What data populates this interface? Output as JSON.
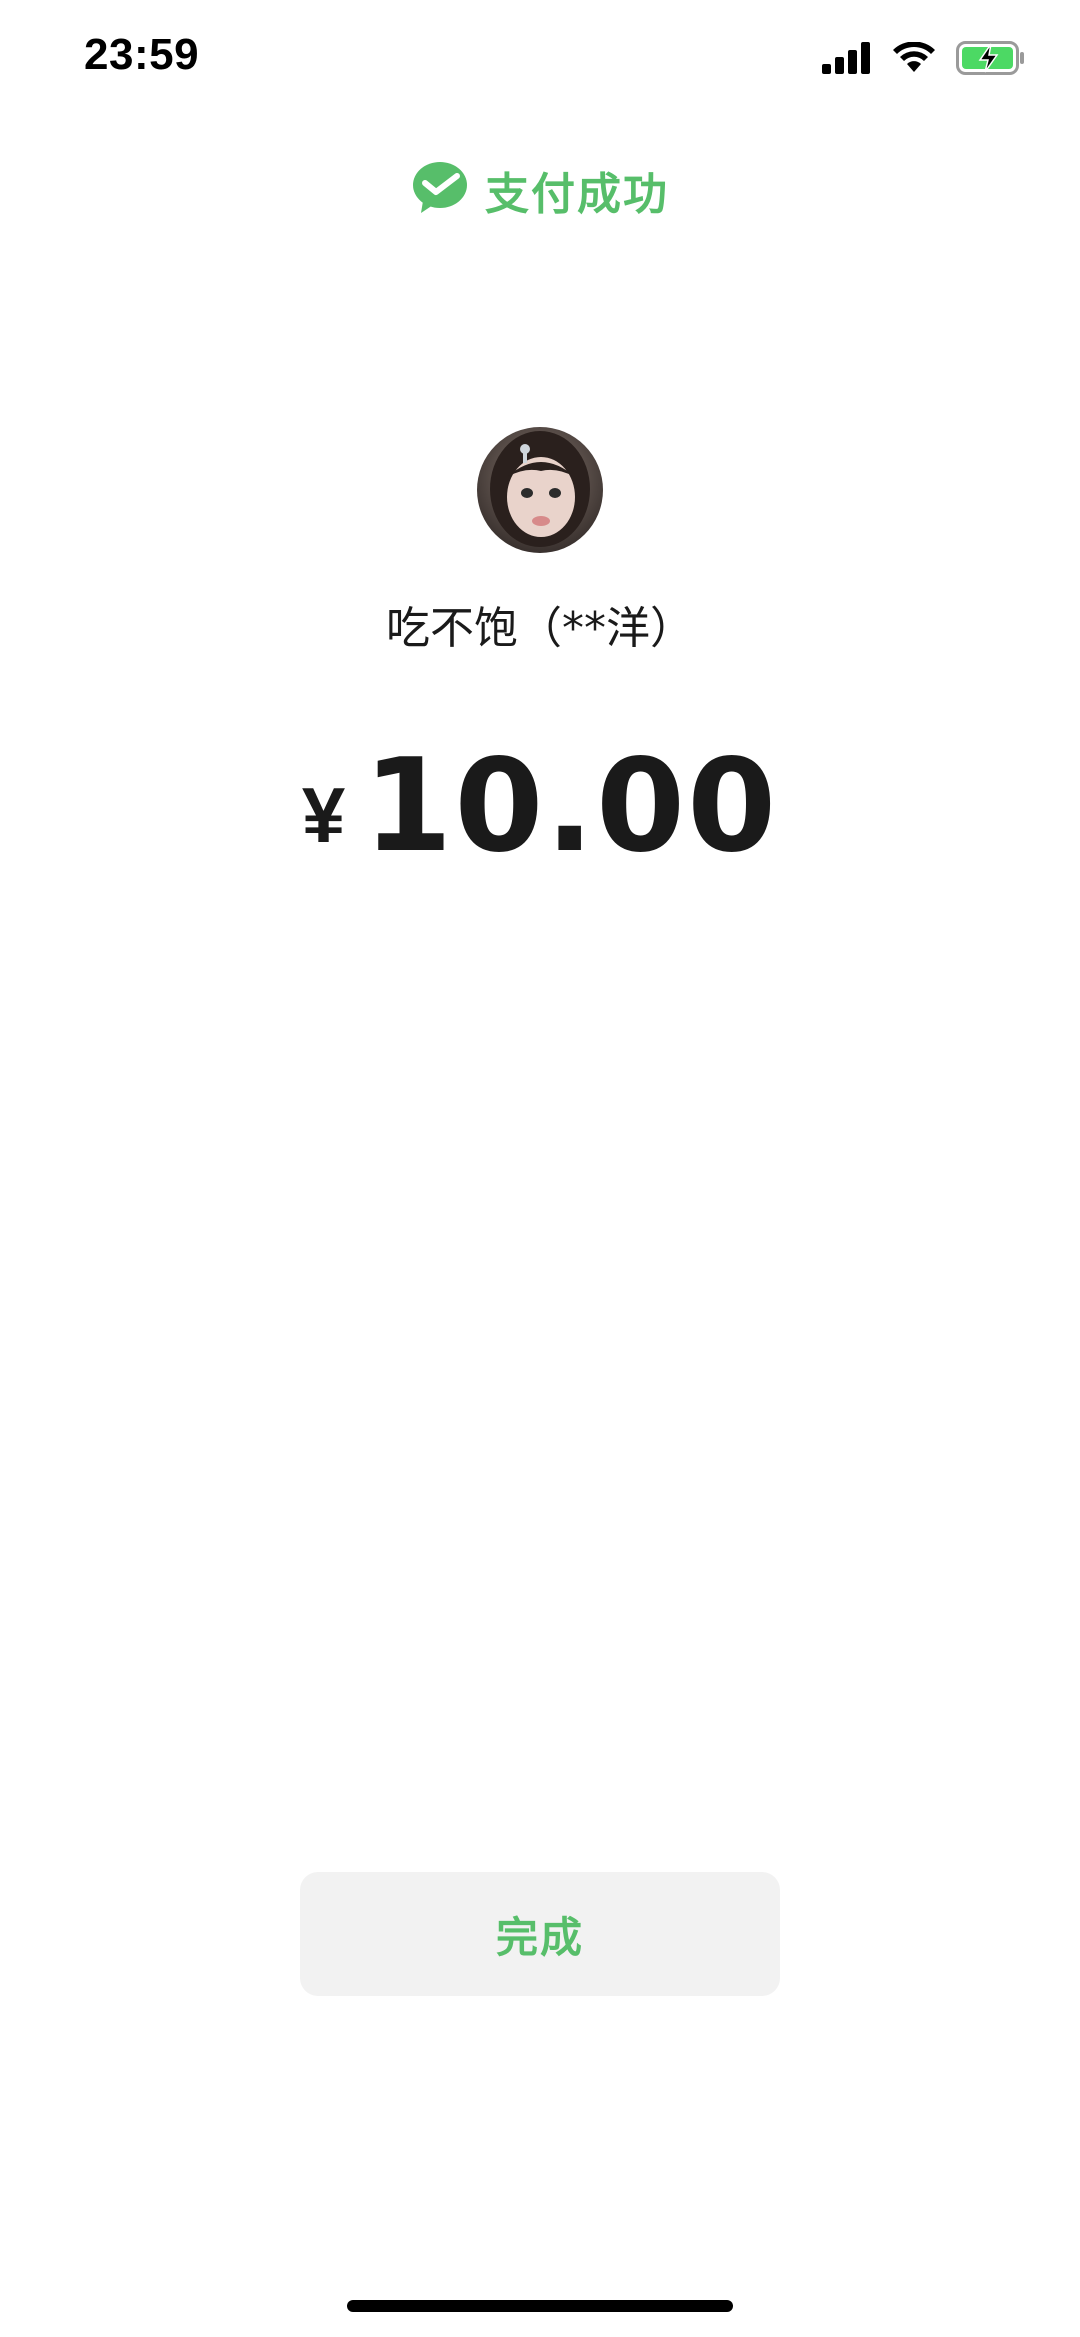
{
  "status_bar": {
    "time": "23:59",
    "icons": [
      "signal-icon",
      "wifi-icon",
      "battery-charging-icon"
    ]
  },
  "header": {
    "icon": "wechat-pay-check-icon",
    "title": "支付成功"
  },
  "payee": {
    "avatar": "avatar",
    "name": "吃不饱（**洋）"
  },
  "amount": {
    "currency": "¥",
    "value": "10.00"
  },
  "actions": {
    "done_label": "完成"
  },
  "colors": {
    "accent": "#57BE6A",
    "button_bg": "#F2F2F2",
    "text": "#1A1A1A",
    "battery_fill": "#4CD964"
  }
}
